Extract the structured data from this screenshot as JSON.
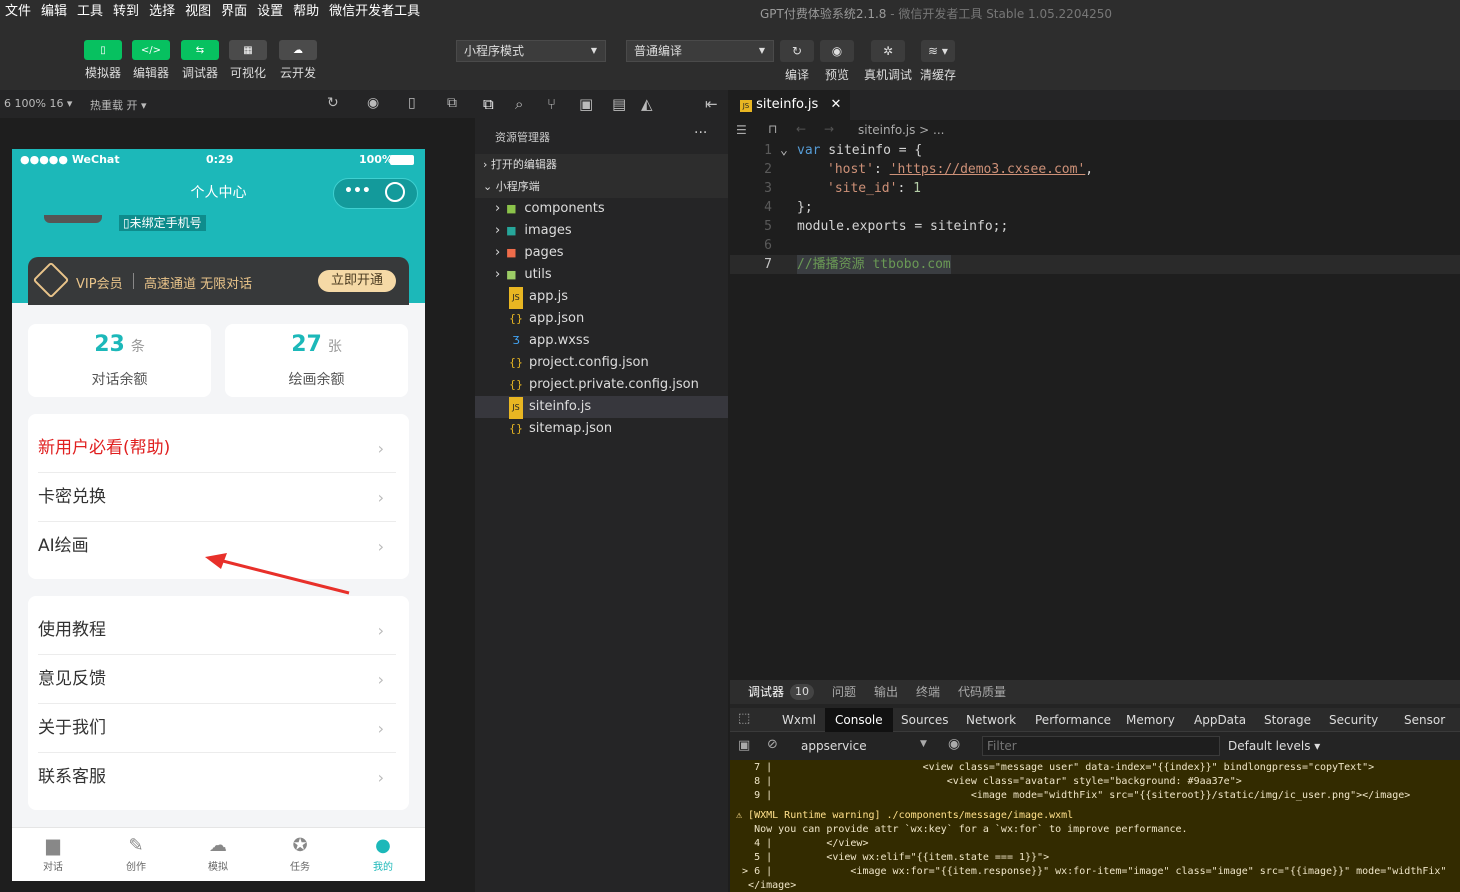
{
  "menu": [
    "文件",
    "编辑",
    "工具",
    "转到",
    "选择",
    "视图",
    "界面",
    "设置",
    "帮助",
    "微信开发者工具"
  ],
  "window_title": "GPT付费体验系统2.1.8",
  "window_subtitle": "- 微信开发者工具 Stable 1.05.2204250",
  "toolbar": {
    "left": [
      "模拟器",
      "编辑器",
      "调试器",
      "可视化",
      "云开发"
    ],
    "mode_select": "小程序模式",
    "compile_select": "普通编译",
    "right": [
      "编译",
      "预览",
      "真机调试",
      "清缓存"
    ]
  },
  "simbar": {
    "zoom": "6 100% 16",
    "hot_reload": "热重载 开"
  },
  "phone": {
    "carrier": "●●●●● WeChat",
    "time": "0:29",
    "battery": "100%",
    "page_title": "个人中心",
    "phone_badge": "未绑定手机号",
    "vip_label": "VIP会员",
    "vip_desc": "高速通道 无限对话",
    "vip_button": "立即开通",
    "stats": [
      {
        "num": "23",
        "unit": "条",
        "label": "对话余额"
      },
      {
        "num": "27",
        "unit": "张",
        "label": "绘画余额"
      }
    ],
    "menu1": [
      "新用户必看(帮助)",
      "卡密兑换",
      "AI绘画"
    ],
    "menu2": [
      "使用教程",
      "意见反馈",
      "关于我们",
      "联系客服"
    ],
    "tabs": [
      "对话",
      "创作",
      "模拟",
      "任务",
      "我的"
    ],
    "accent": "#1cb8b9"
  },
  "explorer": {
    "title": "资源管理器",
    "open_editors": "打开的编辑器",
    "project": "小程序端",
    "items": [
      "components",
      "images",
      "pages",
      "utils",
      "app.js",
      "app.json",
      "app.wxss",
      "project.config.json",
      "project.private.config.json",
      "siteinfo.js",
      "sitemap.json"
    ]
  },
  "editor": {
    "tab": "siteinfo.js",
    "breadcrumb": "siteinfo.js > ...",
    "lines": [
      "1",
      "2",
      "3",
      "4",
      "5",
      "6",
      "7"
    ],
    "c1_kw": "var",
    "c1_rest": " siteinfo = {",
    "c2_key": "'host'",
    "c2_sep": ": ",
    "c2_val": "'https://demo3.cxsee.com'",
    "c2_end": ",",
    "c3_key": "'site_id'",
    "c3_sep": ": ",
    "c3_val": "1",
    "c4": "};",
    "c5": "module.exports = siteinfo;;",
    "c7": "//播播资源 ttbobo.com"
  },
  "devtools": {
    "top_tabs": [
      "调试器",
      "问题",
      "输出",
      "终端",
      "代码质量"
    ],
    "badge": "10",
    "tabs": [
      "Wxml",
      "Console",
      "Sources",
      "Network",
      "Performance",
      "Memory",
      "AppData",
      "Storage",
      "Security",
      "Sensor"
    ],
    "context": "appservice",
    "filter_placeholder": "Filter",
    "levels": "Default levels",
    "console": [
      "    7 |                         <view class=\"message user\" data-index=\"{{index}}\" bindlongpress=\"copyText\">",
      "    8 |                             <view class=\"avatar\" style=\"background: #9aa37e\">",
      "    9 |                                 <image mode=\"widthFix\" src=\"{{siteroot}}/static/img/ic_user.png\"></image>",
      " ⚠ [WXML Runtime warning] ./components/message/image.wxml",
      "    Now you can provide attr `wx:key` for a `wx:for` to improve performance.",
      "    4 |         </view>",
      "    5 |         <view wx:elif=\"{{item.state === 1}}\">",
      "  > 6 |             <image wx:for=\"{{item.response}}\" wx:for-item=\"image\" class=\"image\" src=\"{{image}}\" mode=\"widthFix\"",
      "   </image>"
    ]
  }
}
